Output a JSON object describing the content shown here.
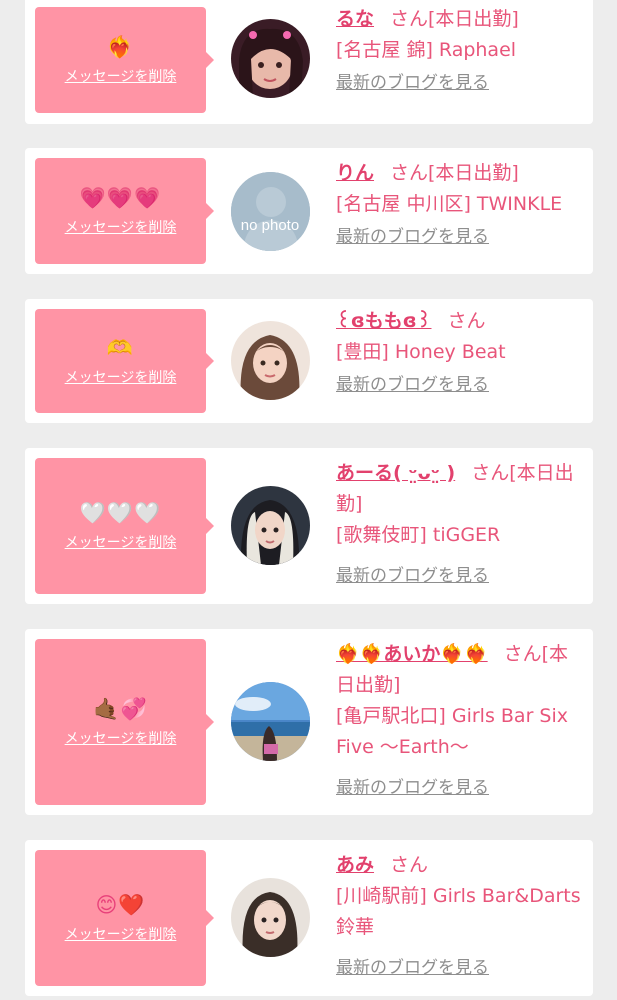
{
  "accent_color": "#ff94a5",
  "name_color": "#e2416d",
  "messages": [
    {
      "emoji": "❤️‍🔥",
      "delete_label": "メッセージを削除",
      "name": "るな",
      "suffix": "さん[本日出勤]",
      "shop": "[名古屋 錦] Raphael",
      "blog_label": "最新のブログを見る",
      "avatar_text": ""
    },
    {
      "emoji": "💗💗💗",
      "delete_label": "メッセージを削除",
      "name": "りん",
      "suffix": "さん[本日出勤]",
      "shop": "[名古屋 中川区] TWINKLE",
      "blog_label": "最新のブログを見る",
      "avatar_text": "no photo"
    },
    {
      "emoji": "🫶",
      "delete_label": "メッセージを削除",
      "name": "꒰ɞももɞ꒱",
      "suffix": "さん",
      "shop": "[豊田] Honey Beat",
      "blog_label": "最新のブログを見る",
      "avatar_text": ""
    },
    {
      "emoji": "🤍🤍🤍",
      "delete_label": "メッセージを削除",
      "name": "あーる( ᵕ̤ᴗᵕ̤ )",
      "suffix": "さん[本日出勤]",
      "shop": "[歌舞伎町] tiGGER",
      "blog_label": "最新のブログを見る",
      "avatar_text": ""
    },
    {
      "emoji": "🤙🏾💞",
      "delete_label": "メッセージを削除",
      "name": "❤️‍🔥❤️‍🔥あいか❤️‍🔥❤️‍🔥",
      "suffix": "さん[本日出勤]",
      "shop": "[亀戸駅北口] Girls Bar Six Five 〜Earth〜",
      "blog_label": "最新のブログを見る",
      "avatar_text": ""
    },
    {
      "emoji": "😊❤️",
      "delete_label": "メッセージを削除",
      "name": "あみ",
      "suffix": "さん",
      "shop": "[川崎駅前] Girls Bar&Darts 鈴華",
      "blog_label": "最新のブログを見る",
      "avatar_text": ""
    }
  ]
}
